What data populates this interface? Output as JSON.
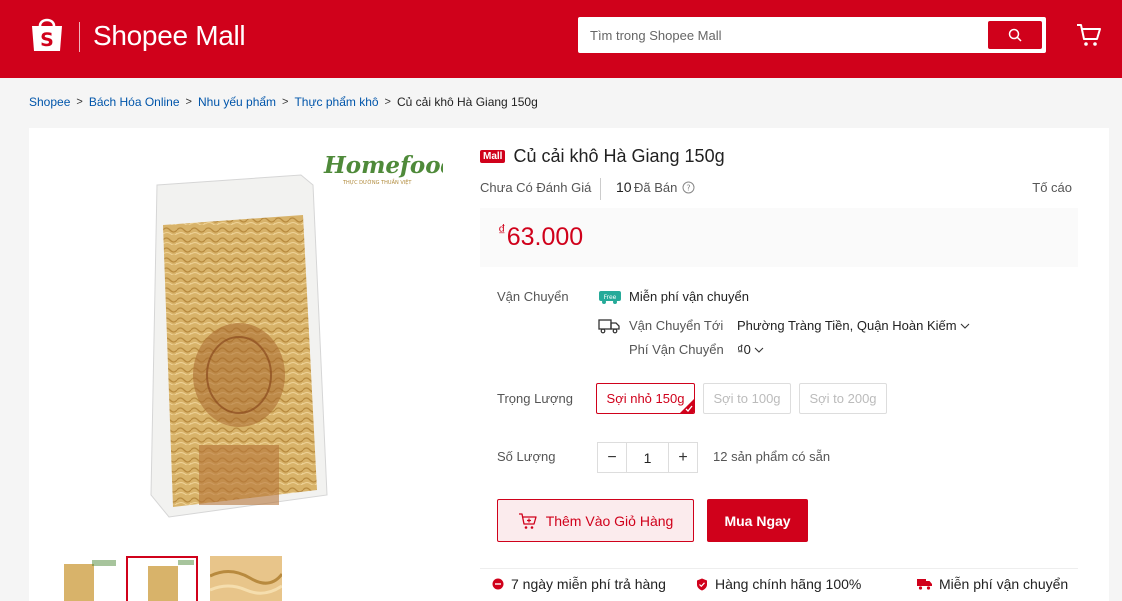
{
  "header": {
    "brand": "Shopee Mall",
    "search_placeholder": "Tìm trong Shopee Mall",
    "accent_color": "#d0011b"
  },
  "breadcrumb": [
    "Shopee",
    "Bách Hóa Online",
    "Nhu yếu phẩm",
    "Thực phẩm khô",
    "Củ cải khô Hà Giang 150g"
  ],
  "product": {
    "mall_badge": "Mall",
    "title": "Củ cải khô Hà Giang 150g",
    "rating_text": "Chưa Có Đánh Giá",
    "sold_count": "10",
    "sold_label": "Đã Bán",
    "report_label": "Tố cáo",
    "currency": "₫",
    "price": "63.000",
    "image_logo": "Homefood",
    "image_logo_sub": "THỰC DƯỠNG THUẦN VIỆT"
  },
  "shipping": {
    "label": "Vận Chuyển",
    "free_badge": "Free",
    "free_text": "Miễn phí vận chuyển",
    "to_label": "Vận Chuyển Tới",
    "to_value": "Phường Tràng Tiền, Quận Hoàn Kiếm",
    "fee_label": "Phí Vận Chuyển",
    "fee_value": "₫0"
  },
  "variants": {
    "label": "Trọng Lượng",
    "options": [
      "Sợi nhỏ 150g",
      "Sợi to 100g",
      "Sợi to 200g"
    ],
    "selected": "Sợi nhỏ 150g"
  },
  "quantity": {
    "label": "Số Lượng",
    "minus": "−",
    "value": "1",
    "plus": "+",
    "stock_text": "12 sản phẩm có sẵn"
  },
  "actions": {
    "add_to_cart": "Thêm Vào Giỏ Hàng",
    "buy_now": "Mua Ngay"
  },
  "guarantees": [
    "7 ngày miễn phí trả hàng",
    "Hàng chính hãng 100%",
    "Miễn phí vận chuyển"
  ]
}
